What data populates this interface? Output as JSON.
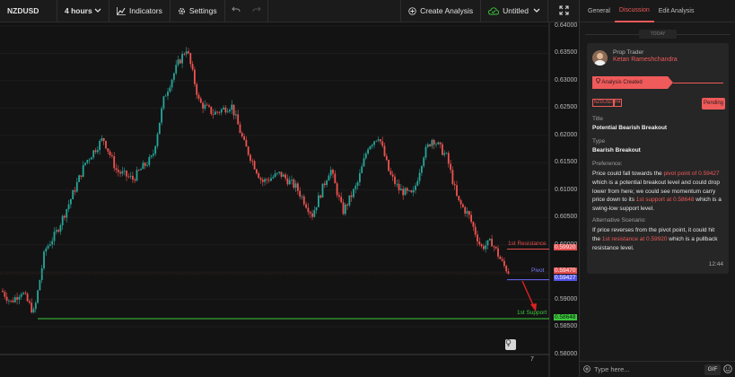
{
  "toolbar": {
    "symbol": "NZDUSD",
    "interval": "4 hours",
    "indicators_label": "Indicators",
    "settings_label": "Settings",
    "create_analysis_label": "Create Analysis",
    "untitled_label": "Untitled",
    "icons": [
      "chevron-down-icon",
      "indicators-icon",
      "gear-icon",
      "undo-icon",
      "redo-icon",
      "plus-circle-icon",
      "cloud-check-icon",
      "fullscreen-icon"
    ]
  },
  "chart": {
    "price_ticks": [
      "0.64000",
      "0.63500",
      "0.63000",
      "0.62500",
      "0.62000",
      "0.61500",
      "0.61000",
      "0.60500",
      "0.60000",
      "0.59500",
      "0.59000",
      "0.58500",
      "0.58000"
    ],
    "date_label": "7",
    "resistance": {
      "label": "1st Resistance",
      "value": "0.59920",
      "color": "#e24e4e"
    },
    "pivot": {
      "label": "Pivot",
      "value": "0.59427",
      "color": "#6a6aff"
    },
    "support": {
      "label": "1st Support",
      "value": "0.58648",
      "color": "#3ec73e"
    },
    "current_price": {
      "value": "0.59470",
      "color": "#e24e4e"
    },
    "bull_color": "#26a69a",
    "bear_color": "#ef5350"
  },
  "panel": {
    "tabs": [
      "General",
      "Discussion",
      "Edit Analysis"
    ],
    "active_tab": "Discussion",
    "today_label": "TODAY",
    "role": "Prop Trader",
    "author": "Ketan Rameshchandra",
    "created_label": "Analysis Created",
    "tags": [
      "NZDUSD",
      "H4"
    ],
    "status": "Pending",
    "title_label": "Title",
    "title_value": "Potential Bearish Breakout",
    "type_label": "Type",
    "type_value": "Bearish Breakout",
    "preference_label": "Preference:",
    "preference_text": {
      "p1": "Price could fall towards the ",
      "h1": "pivot point of 0.59427",
      "p2": " which is a potential breakout level and could drop lower from here; we could see momentum carry price down to its ",
      "h2": "1st support at 0.58648",
      "p3": " which is a swing-low support level."
    },
    "alt_label": "Alternative Scenario:",
    "alt_text": {
      "p1": "If price reverses from the pivot point, it could hit the ",
      "h1": "1st resistance at 0.59920",
      "p2": " which is a pullback resistance level."
    },
    "time": "12:44",
    "message_placeholder": "Type here...",
    "gif_label": "GIF",
    "accent_color": "#ef5a5a"
  }
}
